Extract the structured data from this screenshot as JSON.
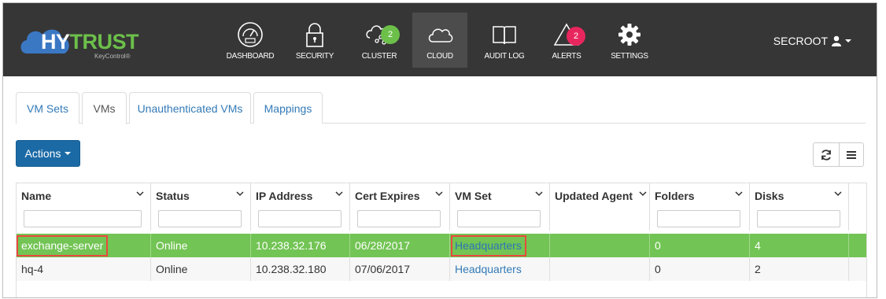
{
  "brand": {
    "name_hy": "HY",
    "name_trust": "TRUST",
    "sub": "KeyControl®"
  },
  "nav": [
    {
      "label": "DASHBOARD",
      "icon": "dashboard-icon"
    },
    {
      "label": "SECURITY",
      "icon": "lock-icon"
    },
    {
      "label": "CLUSTER",
      "icon": "cluster-icon",
      "badge": "2"
    },
    {
      "label": "CLOUD",
      "icon": "cloud-icon",
      "active": true
    },
    {
      "label": "AUDIT LOG",
      "icon": "book-icon"
    },
    {
      "label": "ALERTS",
      "icon": "alert-icon",
      "badge": "2"
    },
    {
      "label": "SETTINGS",
      "icon": "gear-icon"
    }
  ],
  "user": {
    "name": "SECROOT"
  },
  "tabs": [
    "VM Sets",
    "VMs",
    "Unauthenticated VMs",
    "Mappings"
  ],
  "active_tab": "VMs",
  "toolbar": {
    "actions_label": "Actions"
  },
  "table": {
    "columns": [
      "Name",
      "Status",
      "IP Address",
      "Cert Expires",
      "VM Set",
      "Updated Agent",
      "Folders",
      "Disks"
    ],
    "rows": [
      [
        "exchange-server",
        "Online",
        "10.238.32.176",
        "06/28/2017",
        "Headquarters",
        "",
        "0",
        "4"
      ],
      [
        "hq-4",
        "Online",
        "10.238.32.180",
        "07/06/2017",
        "Headquarters",
        "",
        "0",
        "2"
      ]
    ]
  },
  "colors": {
    "nav_bg": "#363636",
    "selected_row": "#72c454",
    "primary": "#1b6aa5",
    "link": "#337ab7",
    "alert": "#e8265e",
    "brand_green": "#6cc04a"
  }
}
